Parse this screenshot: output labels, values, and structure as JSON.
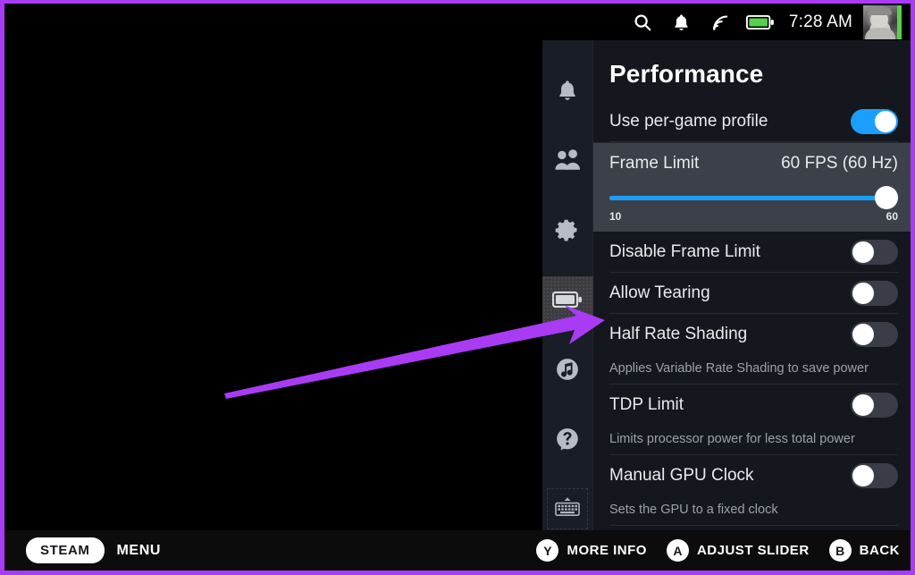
{
  "statusbar": {
    "icons": [
      "search-icon",
      "notification-bell-icon",
      "wifi-icon",
      "battery-icon"
    ],
    "time": "7:28 AM",
    "avatar_status_color": "#57d14c",
    "battery_fill_color": "#57d14c"
  },
  "rail": {
    "items": [
      {
        "icon": "notification-bell-icon",
        "name": "notifications",
        "selected": false
      },
      {
        "icon": "friends-icon",
        "name": "friends",
        "selected": false
      },
      {
        "icon": "gear-icon",
        "name": "quick-settings",
        "selected": false
      },
      {
        "icon": "battery-icon",
        "name": "performance",
        "selected": true
      },
      {
        "icon": "music-note-icon",
        "name": "music",
        "selected": false
      },
      {
        "icon": "help-question-icon",
        "name": "help",
        "selected": false
      }
    ],
    "keyboard_item": {
      "icon": "keyboard-icon",
      "name": "on-screen-keyboard"
    }
  },
  "panel": {
    "title": "Performance",
    "per_game_profile": {
      "label": "Use per-game profile",
      "state": "on"
    },
    "frame_limit": {
      "label": "Frame Limit",
      "value": "60 FPS (60 Hz)",
      "slider_min": "10",
      "slider_max": "60",
      "slider_percent": 100,
      "accent_color": "#1a9fff"
    },
    "rows": [
      {
        "label": "Disable Frame Limit",
        "state": "off",
        "desc": ""
      },
      {
        "label": "Allow Tearing",
        "state": "off",
        "desc": ""
      },
      {
        "label": "Half Rate Shading",
        "state": "off",
        "desc": "Applies Variable Rate Shading to save power"
      },
      {
        "label": "TDP Limit",
        "state": "off",
        "desc": "Limits processor power for less total power"
      },
      {
        "label": "Manual GPU Clock",
        "state": "off",
        "desc": "Sets the GPU to a fixed clock"
      }
    ]
  },
  "bottombar": {
    "steam_label": "STEAM",
    "menu_label": "MENU",
    "hints": [
      {
        "button": "Y",
        "label": "MORE INFO"
      },
      {
        "button": "A",
        "label": "ADJUST SLIDER"
      },
      {
        "button": "B",
        "label": "BACK"
      }
    ]
  },
  "annotation": {
    "arrow_color": "#a93bf5",
    "frame_color": "#a93bf5"
  }
}
